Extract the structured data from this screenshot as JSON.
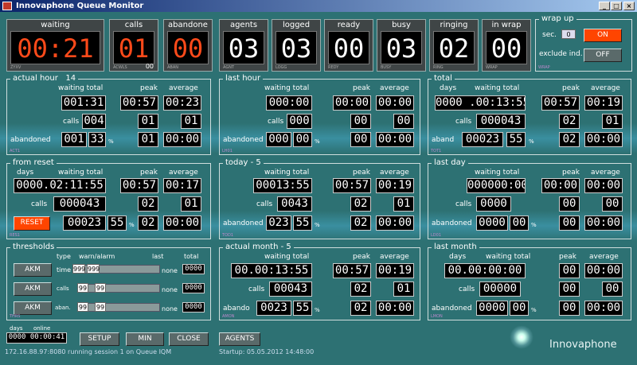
{
  "window": {
    "title": "Innovaphone Queue Monitor",
    "min": "_",
    "max": "□",
    "close": "×"
  },
  "tiles": [
    {
      "label": "waiting",
      "value": "00:21",
      "red": true,
      "tiny": "ZYXV"
    },
    {
      "label": "calls",
      "value": "01",
      "red": true,
      "tiny": "ACWLS",
      "sub": "00"
    },
    {
      "label": "abandone",
      "value": "00",
      "red": true,
      "tiny": "ABAN"
    },
    {
      "label": "agents",
      "value": "03",
      "tiny": "AGNT"
    },
    {
      "label": "logged",
      "value": "03",
      "tiny": "LOGG"
    },
    {
      "label": "ready",
      "value": "00",
      "tiny": "REDY"
    },
    {
      "label": "busy",
      "value": "03",
      "tiny": "BUSY"
    },
    {
      "label": "ringing",
      "value": "02",
      "tiny": "RING"
    },
    {
      "label": "in wrap",
      "value": "00",
      "tiny": "WRAP"
    }
  ],
  "wrapup": {
    "title": "wrap up",
    "sec_label": "sec.",
    "sec_value": "0",
    "on": "ON",
    "exclude": "exclude ind.",
    "off": "OFF",
    "tiny": "WRAP"
  },
  "actual_hour": {
    "title": "actual hour",
    "hour": "14",
    "h_wait": "waiting total",
    "h_peak": "peak",
    "h_avg": "average",
    "wait": "001:31",
    "peak": "00:57",
    "avg": "00:23",
    "calls_label": "calls",
    "calls": "004",
    "calls_peak": "01",
    "calls_avg": "01",
    "ab_label": "abandoned",
    "ab": "001",
    "ab_pct": "33",
    "pct": "%",
    "ab_peak": "01",
    "ab_avg": "00:00",
    "tag": "ACT1"
  },
  "last_hour": {
    "title": "last hour",
    "h_wait": "waiting total",
    "h_peak": "peak",
    "h_avg": "average",
    "wait": "000:00",
    "peak": "00:00",
    "avg": "00:00",
    "calls_label": "calls",
    "calls": "000",
    "calls_peak": "00",
    "calls_avg": "00",
    "ab_label": "abandoned",
    "ab": "000",
    "ab_pct": "00",
    "pct": "%",
    "ab_peak": "00",
    "ab_avg": "00:00",
    "tag": "LH01"
  },
  "total": {
    "title": "total",
    "days": "days",
    "h_wait": "waiting total",
    "h_peak": "peak",
    "h_avg": "average",
    "wait": "0000 .00:13:55",
    "peak": "00:57",
    "avg": "00:19",
    "calls_label": "calls",
    "calls": "000043",
    "calls_peak": "02",
    "calls_avg": "01",
    "ab_label": "aband",
    "ab": "00023",
    "ab_pct": "55",
    "pct": "%",
    "ab_peak": "02",
    "ab_avg": "00:00",
    "tag": "TOT1"
  },
  "from_reset": {
    "title": "from reset",
    "days": "days",
    "h_wait": "waiting total",
    "h_peak": "peak",
    "h_avg": "average",
    "wait": "0000.02:11:55",
    "peak": "00:57",
    "avg": "00:17",
    "calls_label": "calls",
    "calls": "000043",
    "calls_peak": "02",
    "calls_avg": "01",
    "reset": "RESET",
    "ab": "00023",
    "ab_pct": "55",
    "pct": "%",
    "ab_peak": "02",
    "ab_avg": "00:00",
    "tag": "RES1"
  },
  "today": {
    "title": "today - 5",
    "h_wait": "waiting total",
    "h_peak": "peak",
    "h_avg": "average",
    "wait": "00013:55",
    "peak": "00:57",
    "avg": "00:19",
    "calls_label": "calls",
    "calls": "0043",
    "calls_peak": "02",
    "calls_avg": "01",
    "ab_label": "abandoned",
    "ab": "023",
    "ab_pct": "55",
    "pct": "%",
    "ab_peak": "02",
    "ab_avg": "00:00",
    "tag": "TOD1"
  },
  "last_day": {
    "title": "last day",
    "h_wait": "waiting total",
    "h_peak": "peak",
    "h_avg": "average",
    "wait": "000000:00",
    "peak": "00:00",
    "avg": "00:00",
    "calls_label": "calls",
    "calls": "0000",
    "calls_peak": "00",
    "calls_avg": "00",
    "ab_label": "abandoned",
    "ab": "0000",
    "ab_pct": "00",
    "pct": "%",
    "ab_peak": "00",
    "ab_avg": "00:00",
    "tag": "LD01"
  },
  "thresholds": {
    "title": "thresholds",
    "h_type": "type",
    "h_warn": "warn/alarm",
    "h_last": "last",
    "h_total": "total",
    "tag": "THRS",
    "rows": [
      {
        "btn": "AKM",
        "type": "time",
        "warn": "999",
        "alarm": "999",
        "last": "none",
        "total": "0000"
      },
      {
        "btn": "AKM",
        "type": "calls",
        "warn": "99",
        "alarm": "99",
        "last": "none",
        "total": "0000"
      },
      {
        "btn": "AKM",
        "type": "aban.",
        "warn": "99",
        "alarm": "99",
        "last": "none",
        "total": "0000"
      }
    ]
  },
  "actual_month": {
    "title": "actual month - 5",
    "h_wait": "waiting total",
    "h_peak": "peak",
    "h_avg": "average",
    "wait": "00.00:13:55",
    "peak": "00:57",
    "avg": "00:19",
    "calls_label": "calls",
    "calls": "00043",
    "calls_peak": "02",
    "calls_avg": "01",
    "ab_label": "abando",
    "ab": "0023",
    "ab_pct": "55",
    "pct": "%",
    "ab_peak": "02",
    "ab_avg": "00:00",
    "tag": "AMON"
  },
  "last_month": {
    "title": "last month",
    "days": "days",
    "h_wait": "waiting total",
    "h_peak": "peak",
    "h_avg": "average",
    "wait": "00.00:00:00",
    "peak": "00",
    "avg": "00:00",
    "calls_label": "calls",
    "calls": "00000",
    "calls_peak": "00",
    "calls_avg": "00",
    "ab_label": "abandoned",
    "ab": "0000",
    "ab_pct": "00",
    "pct": "%",
    "ab_peak": "00",
    "ab_avg": "00:00",
    "tag": "LMON"
  },
  "footer": {
    "days": "days",
    "online": "online",
    "clock": "0000 00:00:41",
    "setup": "SETUP",
    "min": "MIN",
    "close": "CLOSE",
    "agents": "AGENTS",
    "status": "172.16.88.97:8080 running session 1 on Queue IQM",
    "startup": "Startup: 05.05.2012 14:48:00",
    "brand": "Innovaphone"
  }
}
